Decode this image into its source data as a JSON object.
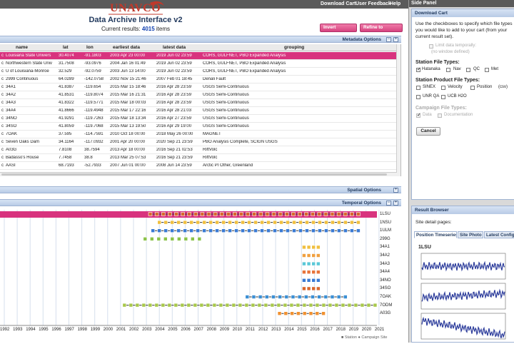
{
  "nav": {
    "download_cart": "Download Cart",
    "user_feedback": "User Feedback",
    "help": "Help"
  },
  "logo": {
    "text": "UNAVCO"
  },
  "app": {
    "title": "Data Archive Interface v2",
    "results_label": "Current results:",
    "results_count": "4015",
    "results_unit": "items"
  },
  "actions": {
    "invert": "Invert selected",
    "refine": "Refine to selected"
  },
  "metadata": {
    "title": "Metadata Options"
  },
  "spatial": {
    "title": "Spatial Options"
  },
  "temporal": {
    "title": "Temporal Options"
  },
  "table": {
    "columns": [
      "name",
      "lat",
      "lon",
      "earliest data",
      "latest data",
      "grouping"
    ],
    "rows": [
      {
        "p": "c",
        "name": "Louisiana State Univers",
        "lat": "30.4074",
        "lon": "-91.1803",
        "earliest": "2003 Apr 23 00:00",
        "latest": "2019 Jun 02 23:59",
        "grouping": "CORS, GULFNET, PBO Expanded Analysis"
      },
      {
        "p": "c",
        "name": "Northwestern State Univ",
        "lat": "31.7508",
        "lon": "-93.0976",
        "earliest": "2004 Jan 16 01:49",
        "latest": "2019 Jun 02 23:59",
        "grouping": "CORS, GULFNET, PBO Expanded Analysis"
      },
      {
        "p": "c",
        "name": "U of Louisiana-Monroe",
        "lat": "32.529",
        "lon": "-92.0759",
        "earliest": "2003 Jun 13 14:00",
        "latest": "2019 Jun 02 23:59",
        "grouping": "CORS, GULFNET, PBO Expanded Analysis"
      },
      {
        "p": "c",
        "name": "2999 Continuous",
        "lat": "64.0289",
        "lon": "-142.0758",
        "earliest": "2002 Nov 15 21:46",
        "latest": "2007 Feb 01 18:45",
        "grouping": "Denali Fault"
      },
      {
        "p": "c",
        "name": "34A1",
        "lat": "41.8387",
        "lon": "-119.654",
        "earliest": "2015 Mar 15 18:46",
        "latest": "2016 Apr 28 23:59",
        "grouping": "USGS Semi-Continuous"
      },
      {
        "p": "c",
        "name": "34A2",
        "lat": "41.8531",
        "lon": "-119.8074",
        "earliest": "2015 Mar 16 21:31",
        "latest": "2016 Apr 28 23:59",
        "grouping": "USGS Semi-Continuous"
      },
      {
        "p": "c",
        "name": "34A3",
        "lat": "41.8322",
        "lon": "-119.5771",
        "earliest": "2015 Mar 18 00:03",
        "latest": "2016 Apr 28 23:59",
        "grouping": "USGS Semi-Continuous"
      },
      {
        "p": "c",
        "name": "34A4",
        "lat": "41.8666",
        "lon": "-119.4948",
        "earliest": "2015 Mar 17 22:16",
        "latest": "2016 Apr 28 21:03",
        "grouping": "USGS Semi-Continuous"
      },
      {
        "p": "c",
        "name": "34NO",
        "lat": "41.9291",
        "lon": "-119.7263",
        "earliest": "2015 Mar 18 13:34",
        "latest": "2016 Apr 27 23:59",
        "grouping": "USGS Semi-Continuous"
      },
      {
        "p": "c",
        "name": "34SO",
        "lat": "41.8059",
        "lon": "-119.7068",
        "earliest": "2015 Mar 13 19:50",
        "latest": "2016 Apr 29 19:00",
        "grouping": "USGS Semi-Continuous"
      },
      {
        "p": "c",
        "name": "7OAK",
        "lat": "37.595",
        "lon": "-114.7591",
        "earliest": "2010 Oct 18 00:00",
        "latest": "2018 May 26 00:00",
        "grouping": "MAGNET"
      },
      {
        "p": "c",
        "name": "Seven Oaks Dam",
        "lat": "34.1164",
        "lon": "-117.0932",
        "earliest": "2001 Apr 20 00:00",
        "latest": "2020 Sep 21 23:59",
        "grouping": "PBO Analysis Complete, SCIGN USGS"
      },
      {
        "p": "c",
        "name": "A03G",
        "lat": "7.8108",
        "lon": "38.7594",
        "earliest": "2013 Apr 18 00:00",
        "latest": "2016 Sep 21 02:53",
        "grouping": "RiftVolc"
      },
      {
        "p": "c",
        "name": "Badasso's House",
        "lat": "7.7458",
        "lon": "38.8",
        "earliest": "2013 Mar 25 07:53",
        "latest": "2016 Sep 21 23:59",
        "grouping": "RiftVolc"
      },
      {
        "p": "c",
        "name": "AASI",
        "lat": "68.7193",
        "lon": "-52.7933",
        "earliest": "2007 Jun 01 00:00",
        "latest": "2008 Jun 14 23:59",
        "grouping": "Arctic PI Other, Greenland"
      }
    ]
  },
  "timeline": {
    "stations": [
      "1LSU",
      "1NSU",
      "1ULM",
      "299G",
      "34A1",
      "34A2",
      "34A3",
      "34A4",
      "34NO",
      "34SO",
      "7OAK",
      "7ODM",
      "A03G"
    ],
    "years": [
      "1992",
      "1993",
      "1994",
      "1995",
      "1996",
      "1997",
      "1998",
      "1999",
      "2000",
      "2001",
      "2002",
      "2003",
      "2004",
      "2005",
      "2006",
      "2007",
      "2008",
      "2009",
      "2010",
      "2011",
      "2012",
      "2013",
      "2014",
      "2015",
      "2016",
      "2017",
      "2018",
      "2019",
      "2020",
      "2021"
    ],
    "legend_station": "Station",
    "legend_campaign": "Campaign Site"
  },
  "side": {
    "title": "Side Panel",
    "download": {
      "title": "Download Cart",
      "instructions": "Use the checkboxes to specify which file types you would like to add to your cart (from your current result set).",
      "limit_label": "Limit data temporally:",
      "limit_note": "(no window defined)",
      "station_types_title": "Station File Types:",
      "station_types": [
        "Hatanaka",
        "Nav",
        "QC",
        "Met"
      ],
      "product_types_title": "Station Product File Types:",
      "product_types": [
        "SINEX",
        "Velocity",
        "Position",
        "(csv)",
        "UNR QA",
        "UCB H2O"
      ],
      "campaign_title": "Campaign File Types:",
      "campaign_types": [
        "Data",
        "Documentation"
      ],
      "cancel": "Cancel"
    },
    "browser": {
      "title": "Result Browser",
      "site_pages": "Site detail pages:",
      "tabs": [
        "Position Timeseries",
        "Site Photo",
        "Latest Configu"
      ],
      "station": "1LSU"
    }
  },
  "colors": {
    "accent_pink": "#d8337e",
    "header_gray": "#5a5a5a",
    "nav_blue": "#b8cbe6"
  }
}
